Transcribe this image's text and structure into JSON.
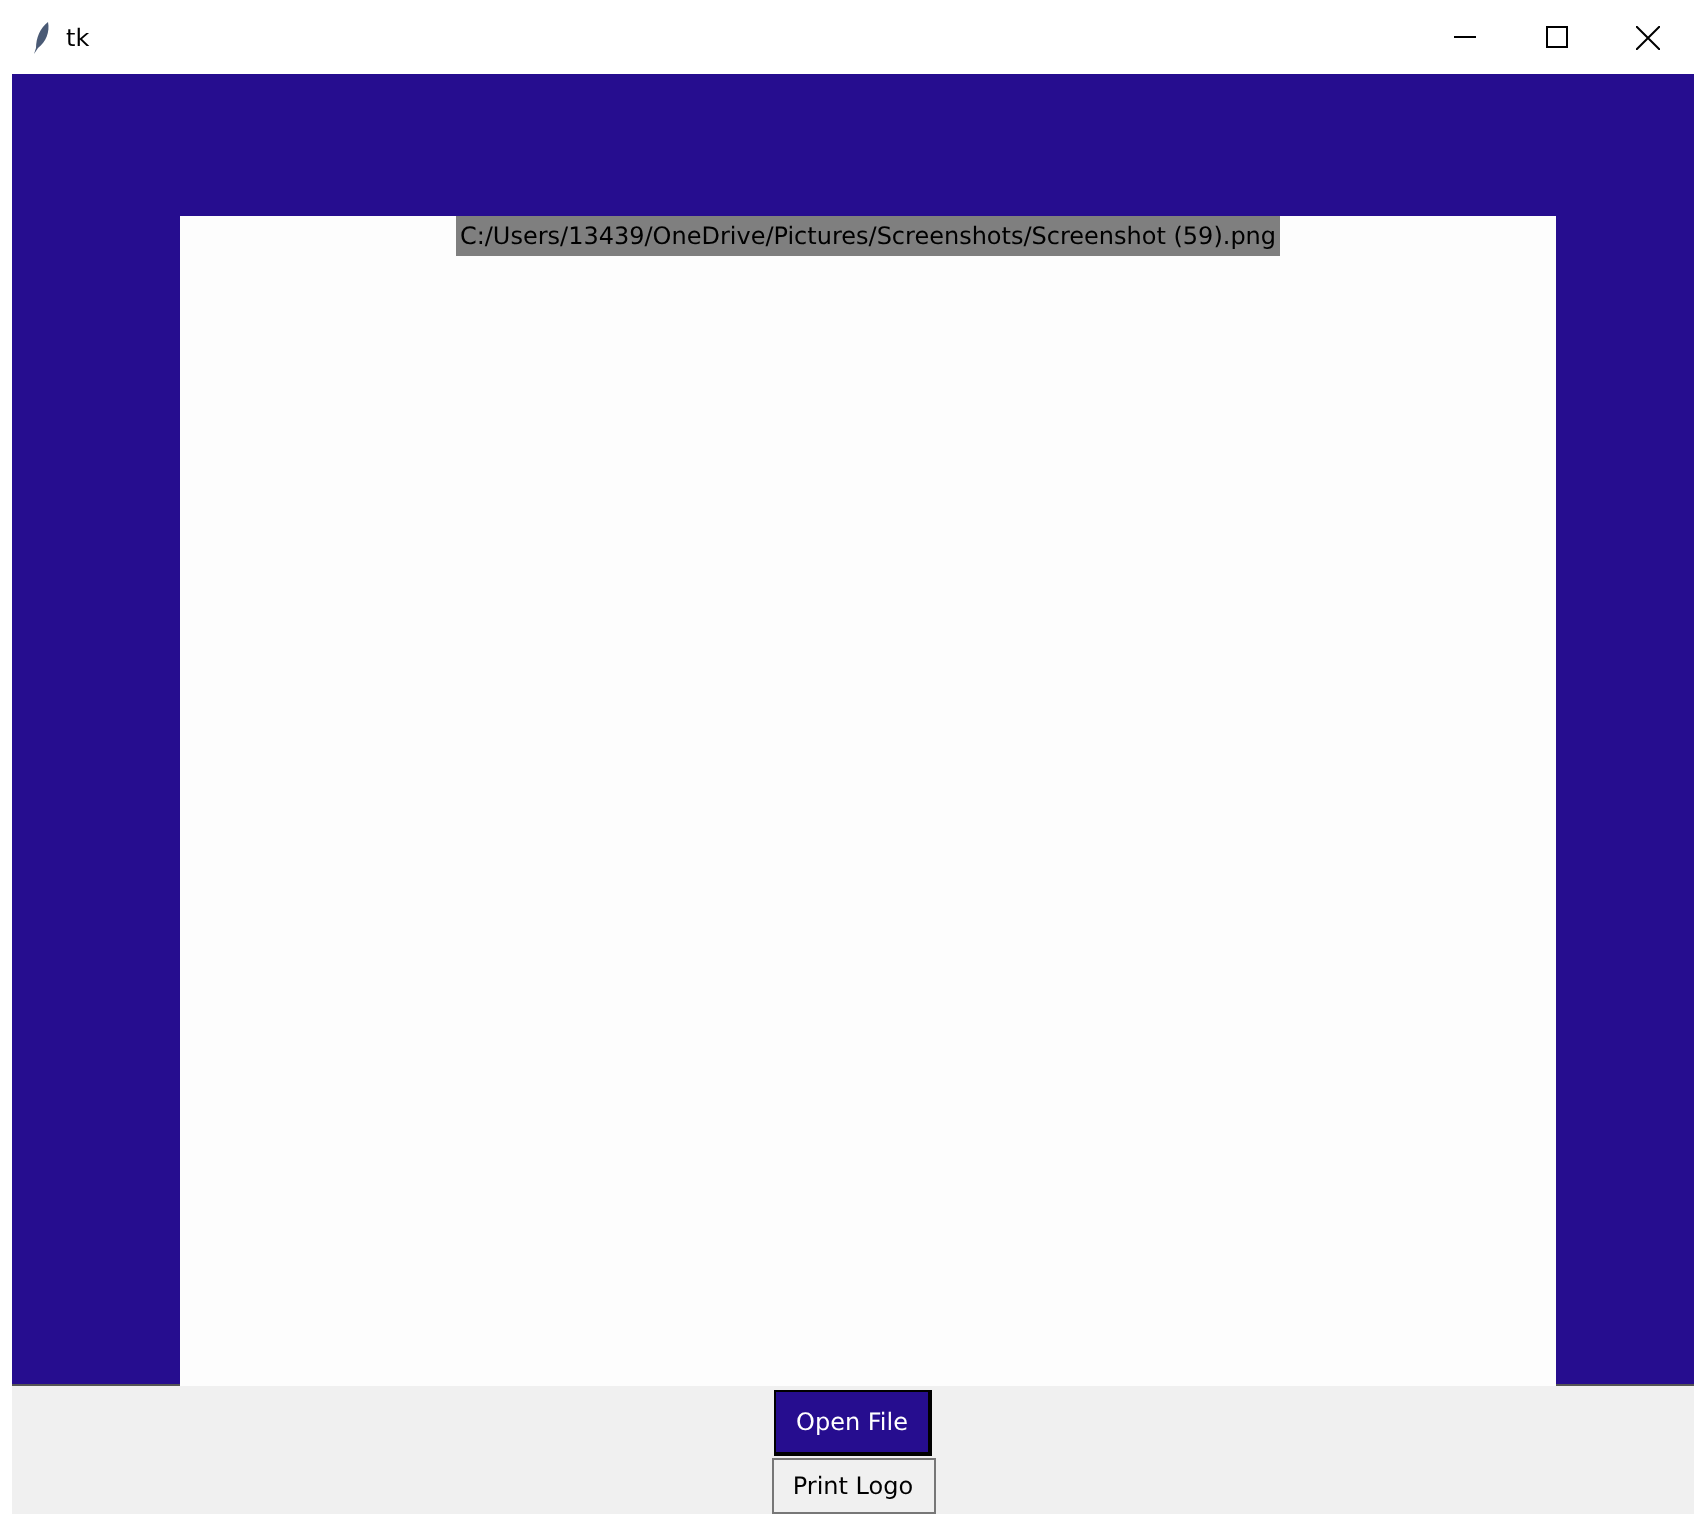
{
  "window": {
    "title": "tk"
  },
  "canvas": {
    "path_label": "C:/Users/13439/OneDrive/Pictures/Screenshots/Screenshot (59).png"
  },
  "buttons": [
    {
      "label": "Open File",
      "kind": "primary"
    },
    {
      "label": "Print Logo",
      "kind": "plain"
    }
  ]
}
